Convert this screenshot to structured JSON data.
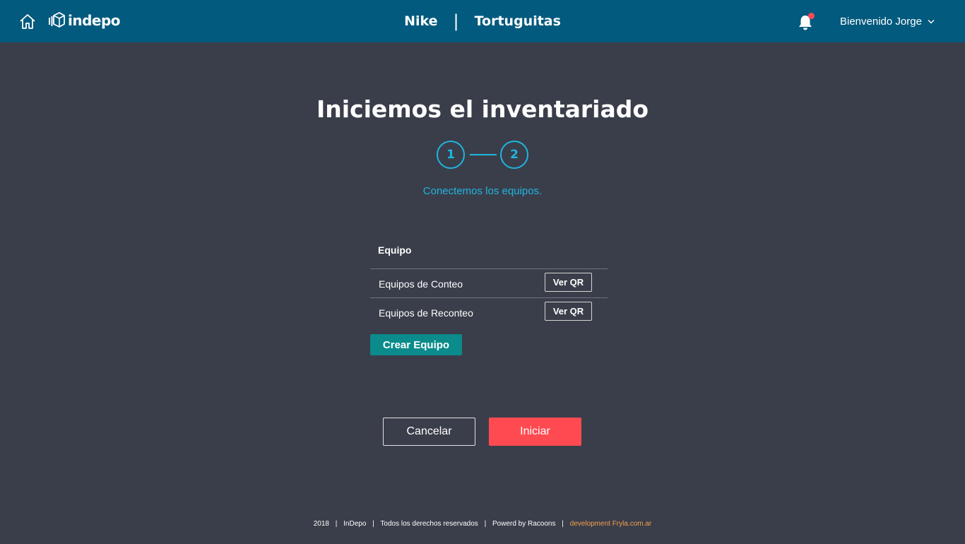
{
  "header": {
    "logo_text": "indepo",
    "stores": [
      "Nike",
      "Tortuguitas"
    ],
    "separator": "|",
    "user_greeting": "Bienvenido Jorge",
    "notification_dot_color": "#ff4a55"
  },
  "main": {
    "title": "Iniciemos el inventariado",
    "steps": [
      "1",
      "2"
    ],
    "subtitle": "Conectemos los equipos.",
    "teams": {
      "header": "Equipo",
      "rows": [
        {
          "name": "Equipos de Conteo",
          "button": "Ver QR"
        },
        {
          "name": "Equipos de Reconteo",
          "button": "Ver QR"
        }
      ],
      "create_button": "Crear Equipo"
    },
    "cancel_button": "Cancelar",
    "start_button": "Iniciar"
  },
  "footer": {
    "year": "2018",
    "brand": "InDepo",
    "rights": "Todos los derechos reservados",
    "powered": "Powerd by Racoons",
    "development": "development Fryla.com.ar"
  },
  "colors": {
    "topbar": "#025a7e",
    "background": "#3a3e4a",
    "accent": "#1fb5e0",
    "create": "#0b8b8b",
    "start": "#ff4a51",
    "dev_link": "#f5a04a"
  }
}
